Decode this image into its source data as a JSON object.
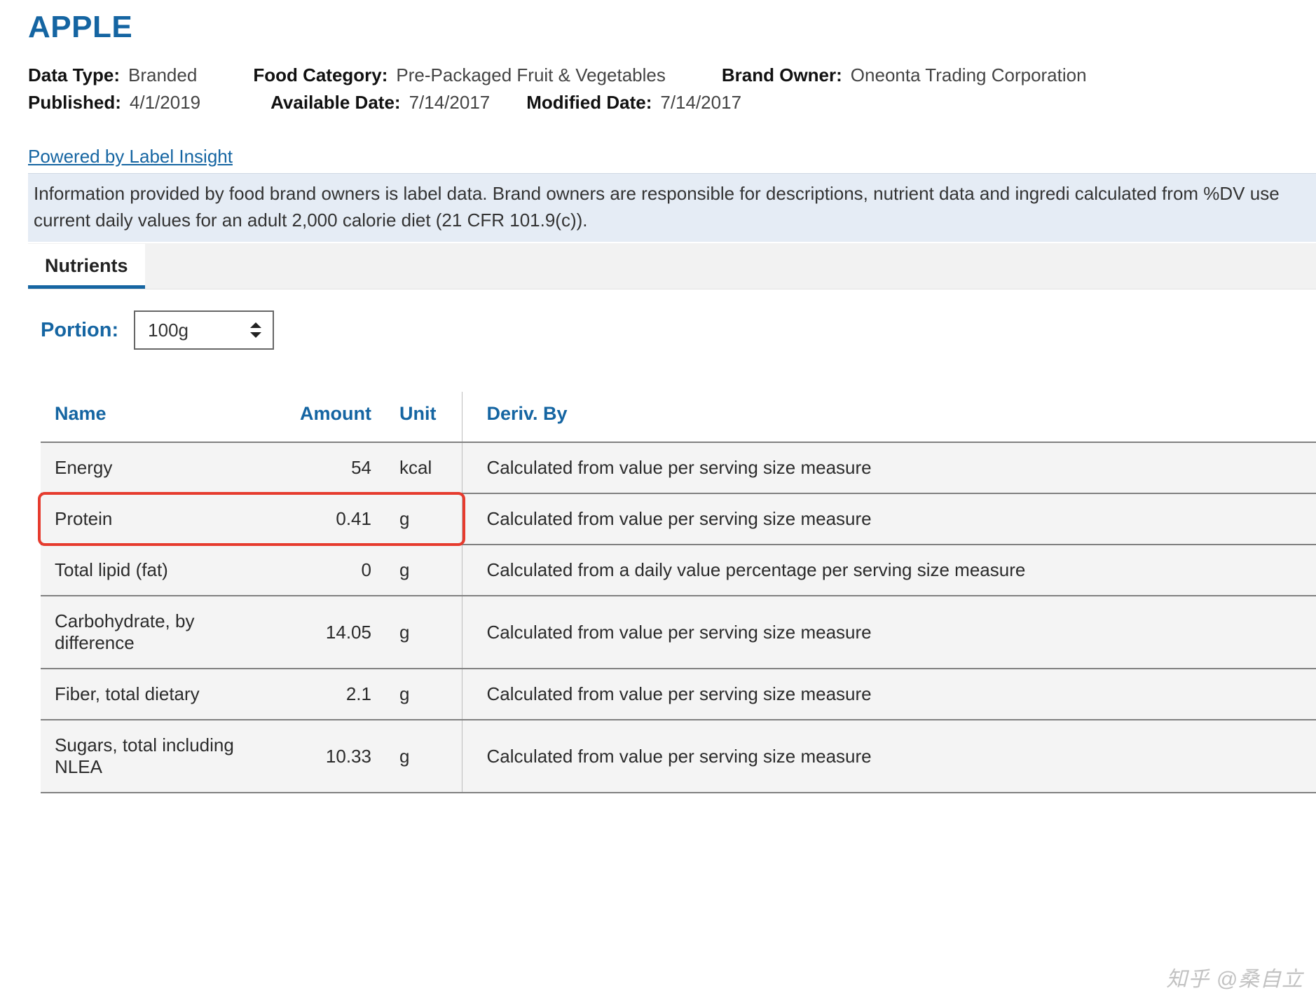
{
  "title": "APPLE",
  "meta": {
    "data_type_label": "Data Type:",
    "data_type": "Branded",
    "food_category_label": "Food Category:",
    "food_category": "Pre-Packaged Fruit & Vegetables",
    "brand_owner_label": "Brand Owner:",
    "brand_owner": "Oneonta Trading Corporation",
    "published_label": "Published:",
    "published": "4/1/2019",
    "available_label": "Available Date:",
    "available": "7/14/2017",
    "modified_label": "Modified Date:",
    "modified": "7/14/2017"
  },
  "insight_link": "Powered by Label Insight",
  "info_text": "Information provided by food brand owners is label data. Brand owners are responsible for descriptions, nutrient data and ingredi   calculated from %DV use current daily values for an adult 2,000 calorie diet (21 CFR 101.9(c)).",
  "tabs": {
    "nutrients": "Nutrients"
  },
  "portion": {
    "label": "Portion:",
    "value": "100g"
  },
  "table": {
    "headers": {
      "name": "Name",
      "amount": "Amount",
      "unit": "Unit",
      "deriv": "Deriv. By"
    },
    "rows": [
      {
        "name": "Energy",
        "amount": "54",
        "unit": "kcal",
        "deriv": "Calculated from value per serving size measure"
      },
      {
        "name": "Protein",
        "amount": "0.41",
        "unit": "g",
        "deriv": "Calculated from value per serving size measure"
      },
      {
        "name": "Total lipid (fat)",
        "amount": "0",
        "unit": "g",
        "deriv": "Calculated from a daily value percentage per serving size measure"
      },
      {
        "name": "Carbohydrate, by difference",
        "amount": "14.05",
        "unit": "g",
        "deriv": "Calculated from value per serving size measure"
      },
      {
        "name": "Fiber, total dietary",
        "amount": "2.1",
        "unit": "g",
        "deriv": "Calculated from value per serving size measure"
      },
      {
        "name": "Sugars, total including NLEA",
        "amount": "10.33",
        "unit": "g",
        "deriv": "Calculated from value per serving size measure"
      }
    ],
    "highlight_row_index": 1
  },
  "watermark": "知乎 @桑自立"
}
